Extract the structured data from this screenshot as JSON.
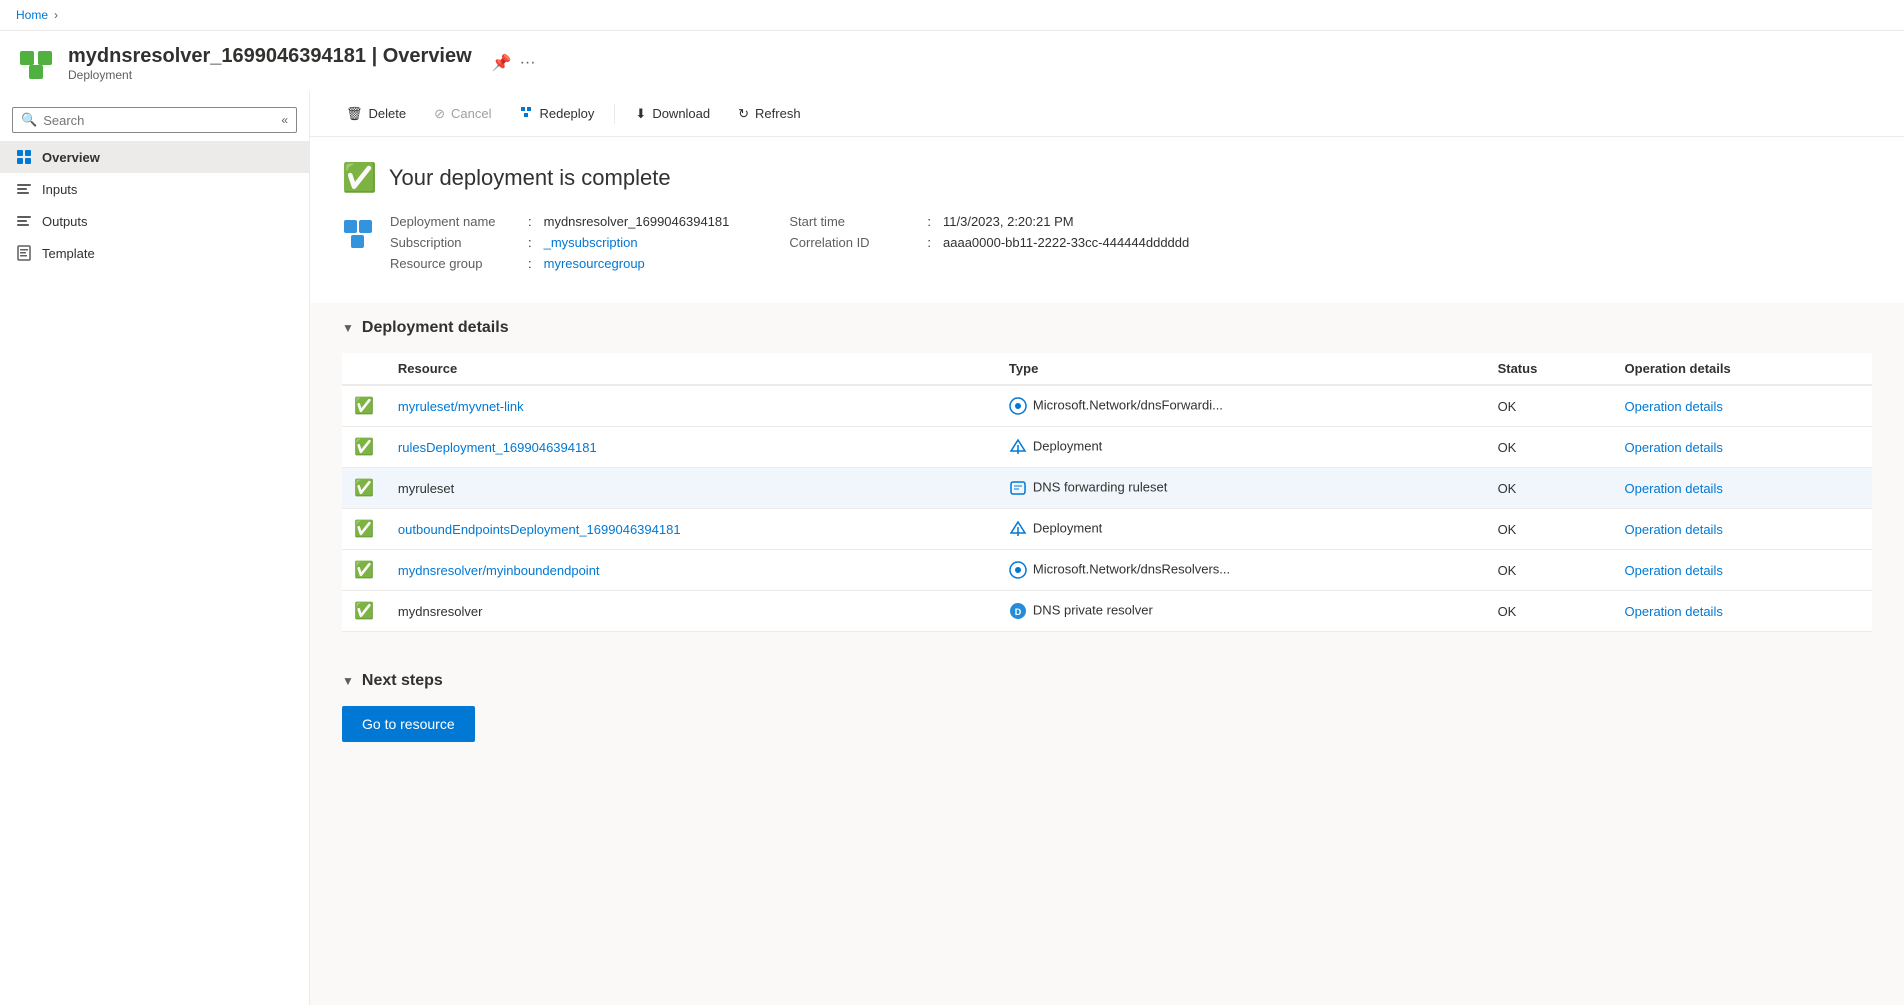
{
  "breadcrumb": {
    "home": "Home"
  },
  "header": {
    "title": "mydnsresolver_1699046394181 | Overview",
    "subtitle": "Deployment"
  },
  "sidebar": {
    "search_placeholder": "Search",
    "nav_items": [
      {
        "id": "overview",
        "label": "Overview",
        "active": true
      },
      {
        "id": "inputs",
        "label": "Inputs",
        "active": false
      },
      {
        "id": "outputs",
        "label": "Outputs",
        "active": false
      },
      {
        "id": "template",
        "label": "Template",
        "active": false
      }
    ]
  },
  "toolbar": {
    "delete_label": "Delete",
    "cancel_label": "Cancel",
    "redeploy_label": "Redeploy",
    "download_label": "Download",
    "refresh_label": "Refresh"
  },
  "status": {
    "title": "Your deployment is complete",
    "deployment_name_label": "Deployment name",
    "deployment_name_value": "mydnsresolver_1699046394181",
    "subscription_label": "Subscription",
    "subscription_value": "_mysubscription",
    "resource_group_label": "Resource group",
    "resource_group_value": "myresourcegroup",
    "start_time_label": "Start time",
    "start_time_value": "11/3/2023, 2:20:21 PM",
    "correlation_id_label": "Correlation ID",
    "correlation_id_value": "aaaa0000-bb11-2222-33cc-444444dddddd"
  },
  "deployment_details": {
    "section_title": "Deployment details",
    "columns": {
      "resource": "Resource",
      "type": "Type",
      "status": "Status",
      "operation_details": "Operation details"
    },
    "rows": [
      {
        "resource": "myruleset/myvnet-link",
        "type": "Microsoft.Network/dnsForwardi...",
        "status": "OK",
        "operation_details": "Operation details",
        "highlighted": false
      },
      {
        "resource": "rulesDeployment_1699046394181",
        "type": "Deployment",
        "status": "OK",
        "operation_details": "Operation details",
        "highlighted": false
      },
      {
        "resource": "myruleset",
        "type": "DNS forwarding ruleset",
        "status": "OK",
        "operation_details": "Operation details",
        "highlighted": true
      },
      {
        "resource": "outboundEndpointsDeployment_1699046394181",
        "type": "Deployment",
        "status": "OK",
        "operation_details": "Operation details",
        "highlighted": false
      },
      {
        "resource": "mydnsresolver/myinboundendpoint",
        "type": "Microsoft.Network/dnsResolvers...",
        "status": "OK",
        "operation_details": "Operation details",
        "highlighted": false
      },
      {
        "resource": "mydnsresolver",
        "type": "DNS private resolver",
        "status": "OK",
        "operation_details": "Operation details",
        "highlighted": false
      }
    ]
  },
  "next_steps": {
    "section_title": "Next steps",
    "go_to_resource_label": "Go to resource"
  }
}
